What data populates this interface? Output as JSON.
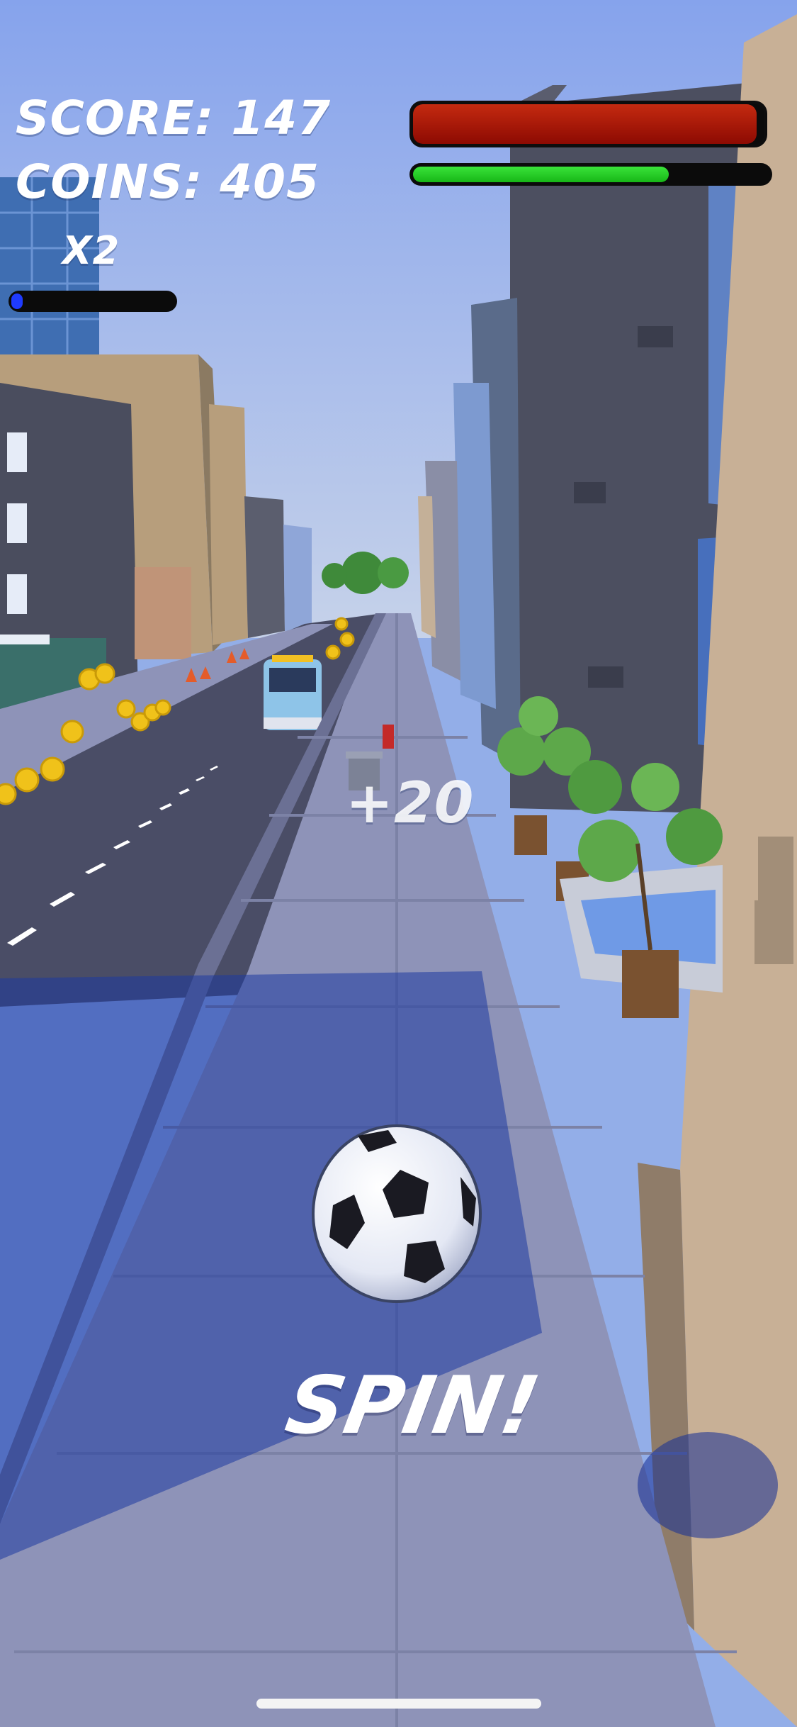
{
  "hud": {
    "score_text": "SCORE: 147",
    "coins_text": "COINS: 405",
    "multiplier_text": "X2",
    "boost_level": 0.07,
    "health_level": 1.0,
    "energy_level": 0.72,
    "colors": {
      "boost": "#1f3bff",
      "health": "#b81c06",
      "energy": "#23d123"
    }
  },
  "popups": {
    "plus_score": "+20",
    "action_label": "SPIN!"
  },
  "scene": {
    "ball": "soccer-ball",
    "sky_color": "#93aee8",
    "sidewalk_color": "#8e93b8",
    "road_color": "#4a4d66",
    "coin_color": "#f0c21a",
    "buildings": [
      "left-glass-tower",
      "left-beige-building",
      "left-gray-building",
      "right-gray-building",
      "right-blue-building",
      "right-beige-wall"
    ],
    "props": [
      "van",
      "trash-can",
      "red-cup",
      "traffic-cones",
      "potted-trees",
      "fountain"
    ]
  }
}
